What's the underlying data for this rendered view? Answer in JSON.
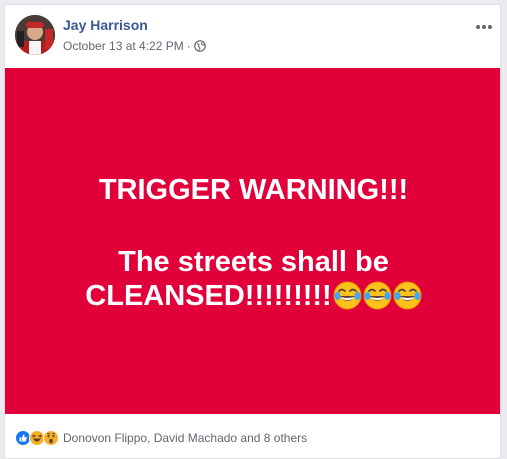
{
  "post": {
    "author": "Jay Harrison",
    "timestamp": "October 13 at 4:22 PM",
    "separator": "·",
    "privacy_icon": "globe-icon",
    "more_icon": "more-options-icon"
  },
  "image": {
    "background_color": "#e2003b",
    "line1": "TRIGGER WARNING!!!",
    "line2": "The streets shall be",
    "line3": "CLEANSED!!!!!!!!!",
    "emojis": [
      "face-with-tears-of-joy",
      "face-with-tears-of-joy",
      "face-with-tears-of-joy"
    ]
  },
  "footer": {
    "reaction_icons": [
      "like-icon",
      "haha-icon",
      "wow-icon"
    ],
    "reaction_text": "Donovon Flippo, David Machado and 8 others"
  },
  "colors": {
    "author": "#385898",
    "meta": "#616770",
    "like_blue": "#1877f2",
    "reaction_yellow": "#f7b125"
  }
}
